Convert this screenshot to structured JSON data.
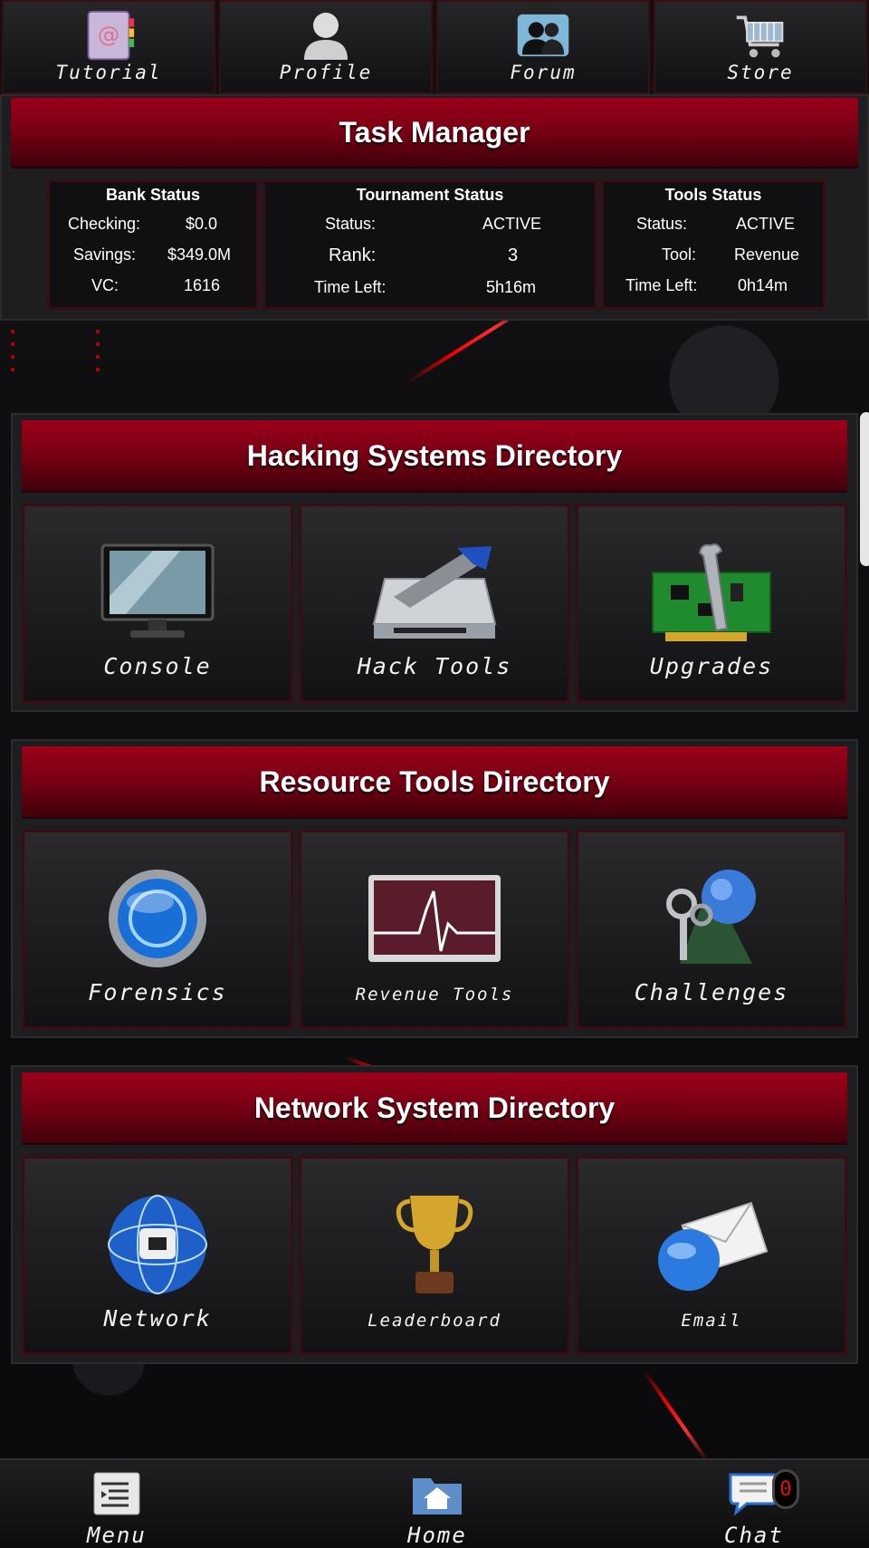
{
  "top_nav": [
    {
      "label": "Tutorial",
      "icon": "address-book-icon"
    },
    {
      "label": "Profile",
      "icon": "user-icon"
    },
    {
      "label": "Forum",
      "icon": "people-icon"
    },
    {
      "label": "Store",
      "icon": "cart-icon"
    }
  ],
  "task_manager": {
    "title": "Task Manager",
    "bank": {
      "heading": "Bank Status",
      "rows": [
        {
          "label": "Checking:",
          "value": "$0.0"
        },
        {
          "label": "Savings:",
          "value": "$349.0M"
        },
        {
          "label": "VC:",
          "value": "1616"
        }
      ]
    },
    "tournament": {
      "heading": "Tournament Status",
      "rows": [
        {
          "label": "Status:",
          "value": "ACTIVE"
        },
        {
          "label": "Rank:",
          "value": "3"
        },
        {
          "label": "Time Left:",
          "value": "5h16m"
        }
      ]
    },
    "tools": {
      "heading": "Tools Status",
      "rows": [
        {
          "label": "Status:",
          "value": "ACTIVE"
        },
        {
          "label": "Tool:",
          "value": "Revenue"
        },
        {
          "label": "Time Left:",
          "value": "0h14m"
        }
      ]
    }
  },
  "directories": [
    {
      "title": "Hacking Systems Directory",
      "tiles": [
        {
          "label": "Console",
          "icon": "monitor-icon"
        },
        {
          "label": "Hack Tools",
          "icon": "hard-drive-tools-icon"
        },
        {
          "label": "Upgrades",
          "icon": "circuit-board-wrench-icon"
        }
      ]
    },
    {
      "title": "Resource Tools Directory",
      "tiles": [
        {
          "label": "Forensics",
          "icon": "blue-orb-icon"
        },
        {
          "label": "Revenue Tools",
          "icon": "waveform-monitor-icon"
        },
        {
          "label": "Challenges",
          "icon": "globe-keys-icon"
        }
      ]
    },
    {
      "title": "Network System Directory",
      "tiles": [
        {
          "label": "Network",
          "icon": "network-globe-icon"
        },
        {
          "label": "Leaderboard",
          "icon": "trophy-icon"
        },
        {
          "label": "Email",
          "icon": "email-globe-icon"
        }
      ]
    }
  ],
  "bottom_bar": {
    "menu": {
      "label": "Menu",
      "icon": "list-document-icon"
    },
    "home": {
      "label": "Home",
      "icon": "home-folder-icon"
    },
    "chat": {
      "label": "Chat",
      "icon": "chat-bubble-icon",
      "badge": "0"
    }
  },
  "colors": {
    "accent_red": "#9a0018",
    "badge_red": "#e31010"
  }
}
